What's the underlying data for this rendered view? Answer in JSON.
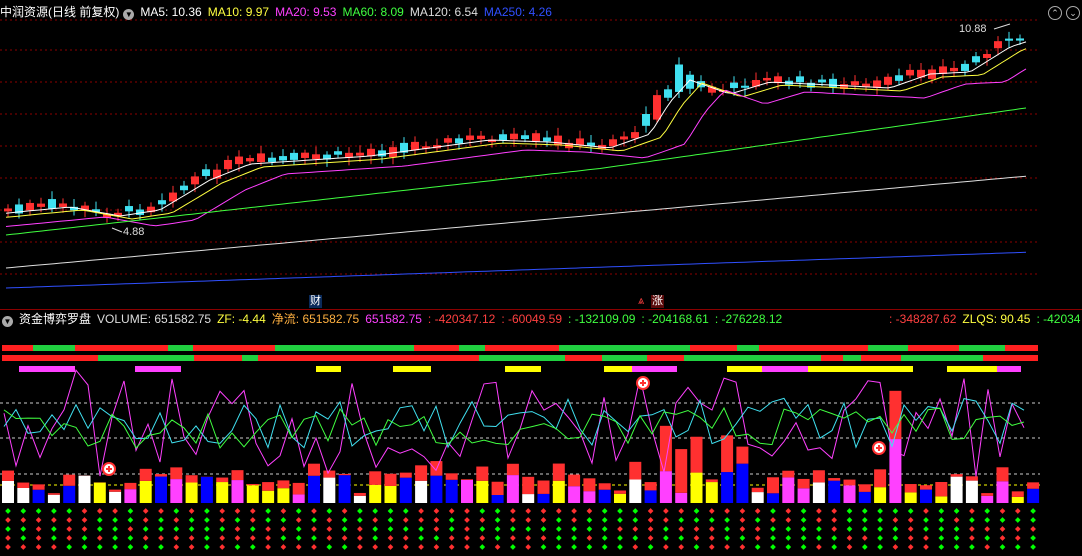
{
  "top": {
    "stock_title": "中润资源(日线 前复权)",
    "ma": [
      {
        "label": "MA5: 10.36",
        "color": "#ffffff"
      },
      {
        "label": "MA10: 9.97",
        "color": "#ffff40"
      },
      {
        "label": "MA20: 9.53",
        "color": "#ff40ff"
      },
      {
        "label": "MA60: 8.09",
        "color": "#40ff40"
      },
      {
        "label": "MA120: 6.54",
        "color": "#dddddd"
      },
      {
        "label": "MA250: 4.26",
        "color": "#3050ff"
      }
    ],
    "high_label": "10.88",
    "low_label": "4.88",
    "marker_finance": "财",
    "marker_rise": "涨"
  },
  "bottom": {
    "indicator_title": "资金博弈罗盘",
    "values": [
      {
        "label": "VOLUME: 651582.75",
        "color": "#dddddd"
      },
      {
        "label": "ZF: -4.44",
        "color": "#ffff40"
      },
      {
        "label": "净流: 651582.75",
        "color": "#ffb040"
      },
      {
        "label": "651582.75",
        "color": "#ff40ff"
      },
      {
        "label": ": -420347.12",
        "color": "#ff4040"
      },
      {
        "label": ": -60049.59",
        "color": "#ff4040"
      },
      {
        "label": ": -132109.09",
        "color": "#40ff40"
      },
      {
        "label": ": -204168.61",
        "color": "#40ff40"
      },
      {
        "label": ": -276228.12",
        "color": "#40ff40"
      }
    ],
    "right_values": [
      {
        "label": ": -348287.62",
        "color": "#ff4040"
      },
      {
        "label": "ZLQS: 90.45",
        "color": "#ffff40"
      },
      {
        "label": ": -42034",
        "color": "#40ff40"
      }
    ]
  },
  "colors": {
    "up": "#ff3030",
    "down": "#40e0f0",
    "grid": "#8b0000",
    "magenta": "#ff40ff",
    "yellow": "#ffff00",
    "blue": "#0000ff",
    "green": "#00ff00",
    "white": "#ffffff"
  },
  "icons": {
    "dropdown": "chevron-down-icon",
    "panel_up": "chevron-up-icon",
    "panel_down": "chevron-down-icon"
  }
}
